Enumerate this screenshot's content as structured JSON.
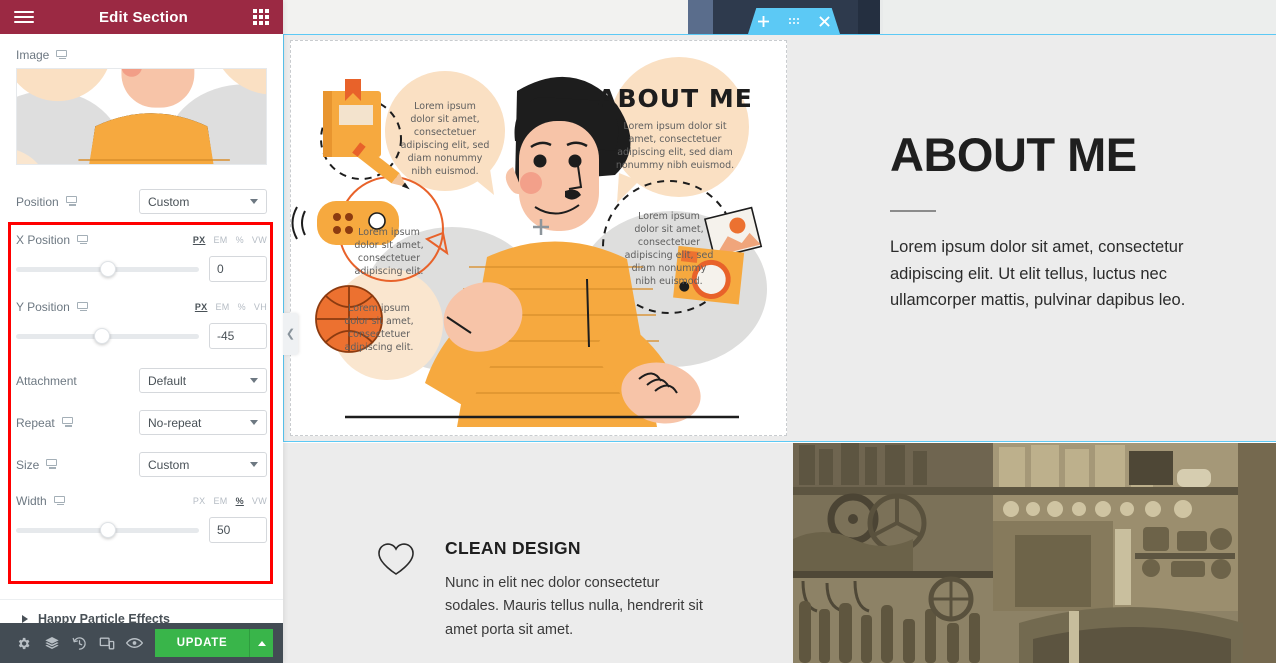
{
  "panel": {
    "title": "Edit Section",
    "menu_icon": "hamburger-icon",
    "apps_icon": "grid-apps-icon",
    "image_label": "Image",
    "controls": [
      {
        "label": "Position",
        "type": "select",
        "value": "Custom",
        "responsive": true
      },
      {
        "label": "X Position",
        "type": "slider",
        "value": "0",
        "units": [
          "PX",
          "EM",
          "%",
          "VW"
        ],
        "active_unit": "PX",
        "knob_pct": 50,
        "responsive": true
      },
      {
        "label": "Y Position",
        "type": "slider",
        "value": "-45",
        "units": [
          "PX",
          "EM",
          "%",
          "VH"
        ],
        "active_unit": "PX",
        "knob_pct": 47,
        "responsive": true
      },
      {
        "label": "Attachment",
        "type": "select",
        "value": "Default",
        "responsive": false
      },
      {
        "label": "Repeat",
        "type": "select",
        "value": "No-repeat",
        "responsive": true
      },
      {
        "label": "Size",
        "type": "select",
        "value": "Custom",
        "responsive": true
      },
      {
        "label": "Width",
        "type": "slider",
        "value": "50",
        "units": [
          "PX",
          "EM",
          "%",
          "VW"
        ],
        "active_unit": "%",
        "knob_pct": 50,
        "responsive": true
      }
    ],
    "accordion": {
      "label": "Happy Particle Effects",
      "icon": "chevron-right-icon"
    },
    "footer": {
      "icons": [
        "settings-gear-icon",
        "navigator-layers-icon",
        "history-revisions-icon",
        "responsive-mode-icon",
        "preview-eye-icon"
      ],
      "update_label": "UPDATE",
      "update_caret_icon": "chevron-up-icon"
    },
    "collapse_icon": "chevron-left-icon",
    "highlight_color": "#ff0000",
    "header_color": "#9b2943",
    "update_color": "#39b54a"
  },
  "canvas": {
    "section_toolbar": {
      "add_icon": "plus-icon",
      "drag_icon": "drag-handle-dots-icon",
      "close_icon": "close-x-icon",
      "color": "#5cc9f5"
    },
    "left_column": {
      "illustration": {
        "alt": "about-me-illustration",
        "heading": "ABOUT ME",
        "bubble_texts": [
          "Lorem ipsum dolor sit amet, consectetuer adipiscing elit, sed diam nonummy nibh euismod.",
          "Lorem ipsum dolor sit amet, consectetuer adipiscing elit, sed diam nonummy nibh euismod.",
          "Lorem ipsum dolor sit amet, consectetuer adipiscing elit.",
          "Lorem ipsum dolor sit amet, consectetuer adipiscing elit.",
          "Lorem ipsum dolor sit amet, consectetuer adipiscing elit, sed diam nonummy nibh euismod."
        ],
        "objects": [
          "book-icon",
          "pencil-icon",
          "game-controller-icon",
          "basketball-icon",
          "camera-icon"
        ]
      }
    },
    "right_column": {
      "title": "ABOUT ME",
      "text": "Lorem ipsum dolor sit amet, consectetur adipiscing elit. Ut elit tellus, luctus nec ullamcorper mattis, pulvinar dapibus leo."
    },
    "feature": {
      "icon": "heart-outline-icon",
      "title": "CLEAN DESIGN",
      "text": "Nunc in elit nec dolor consectetur sodales. Mauris tellus nulla, hendrerit sit amet porta sit amet."
    },
    "photo": {
      "alt": "vintage-garage-workshop-photo"
    }
  }
}
